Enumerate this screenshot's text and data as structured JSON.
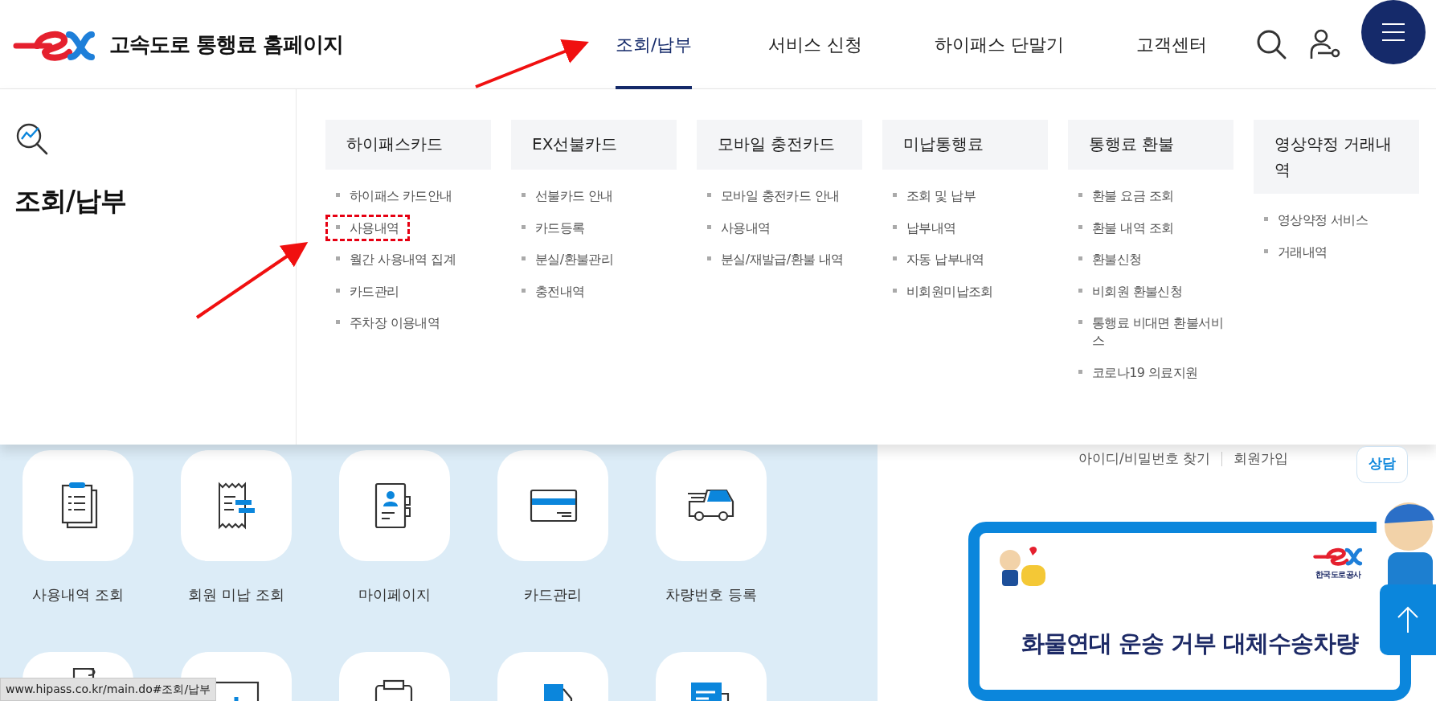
{
  "header": {
    "site_title": "고속도로 통행료 홈페이지",
    "nav": [
      {
        "label": "조회/납부",
        "selected": true
      },
      {
        "label": "서비스 신청",
        "selected": false
      },
      {
        "label": "하이패스 단말기",
        "selected": false
      },
      {
        "label": "고객센터",
        "selected": false
      }
    ]
  },
  "mega_menu": {
    "title": "조회/납부",
    "columns": [
      {
        "heading": "하이패스카드",
        "items": [
          {
            "label": "하이패스 카드안내",
            "highlighted": false
          },
          {
            "label": "사용내역",
            "highlighted": true
          },
          {
            "label": "월간 사용내역 집계",
            "highlighted": false
          },
          {
            "label": "카드관리",
            "highlighted": false
          },
          {
            "label": "주차장 이용내역",
            "highlighted": false
          }
        ]
      },
      {
        "heading": "EX선불카드",
        "items": [
          {
            "label": "선불카드 안내",
            "highlighted": false
          },
          {
            "label": "카드등록",
            "highlighted": false
          },
          {
            "label": "분실/환불관리",
            "highlighted": false
          },
          {
            "label": "충전내역",
            "highlighted": false
          }
        ]
      },
      {
        "heading": "모바일 충전카드",
        "items": [
          {
            "label": "모바일 충전카드 안내",
            "highlighted": false
          },
          {
            "label": "사용내역",
            "highlighted": false
          },
          {
            "label": "분실/재발급/환불 내역",
            "highlighted": false
          }
        ]
      },
      {
        "heading": "미납통행료",
        "items": [
          {
            "label": "조회 및 납부",
            "highlighted": false
          },
          {
            "label": "납부내역",
            "highlighted": false
          },
          {
            "label": "자동 납부내역",
            "highlighted": false
          },
          {
            "label": "비회원미납조회",
            "highlighted": false
          }
        ]
      },
      {
        "heading": "통행료 환불",
        "items": [
          {
            "label": "환불 요금 조회",
            "highlighted": false
          },
          {
            "label": "환불 내역 조회",
            "highlighted": false
          },
          {
            "label": "환불신청",
            "highlighted": false
          },
          {
            "label": "비회원 환불신청",
            "highlighted": false
          },
          {
            "label": "통행료 비대면 환불서비스",
            "highlighted": false
          },
          {
            "label": "코로나19 의료지원",
            "highlighted": false
          }
        ]
      },
      {
        "heading": "영상약정 거래내역",
        "items": [
          {
            "label": "영상약정 서비스",
            "highlighted": false
          },
          {
            "label": "거래내역",
            "highlighted": false
          }
        ]
      }
    ]
  },
  "quick_menu": [
    {
      "label": "사용내역 조회"
    },
    {
      "label": "회원 미납 조회"
    },
    {
      "label": "마이페이지"
    },
    {
      "label": "카드관리"
    },
    {
      "label": "차량번호 등록"
    }
  ],
  "login_links": [
    "아이디/비밀번호 찾기",
    "회원가입"
  ],
  "banner": {
    "logo_caption": "한국도로공사",
    "headline": "화물연대 운송 거부 대체수송차량"
  },
  "chat_bubble": "상담",
  "status_bar": "www.hipass.co.kr/main.do#조회/납부"
}
